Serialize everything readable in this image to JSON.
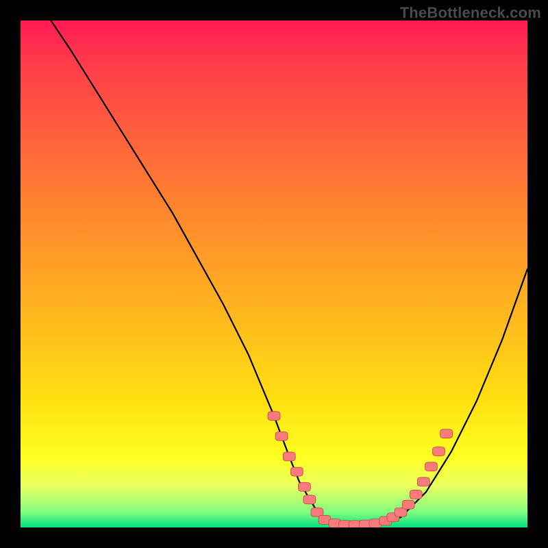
{
  "watermark": "TheBottleneck.com",
  "chart_data": {
    "type": "line",
    "title": "",
    "xlabel": "",
    "ylabel": "",
    "xlim": [
      0,
      100
    ],
    "ylim": [
      0,
      100
    ],
    "series": [
      {
        "name": "curve",
        "x": [
          6,
          10,
          15,
          20,
          25,
          30,
          35,
          40,
          45,
          50,
          53,
          55,
          58,
          60,
          62,
          65,
          68,
          70,
          75,
          80,
          85,
          90,
          95,
          100
        ],
        "y": [
          100,
          94,
          86,
          78,
          70,
          62,
          53,
          44,
          34,
          22,
          14,
          9,
          4,
          1.5,
          0.5,
          0.3,
          0.3,
          0.6,
          2,
          7,
          15,
          25,
          37,
          51
        ]
      }
    ],
    "markers": [
      {
        "x": 50.0,
        "y": 22.0
      },
      {
        "x": 51.5,
        "y": 18.0
      },
      {
        "x": 53.0,
        "y": 14.0
      },
      {
        "x": 54.5,
        "y": 11.0
      },
      {
        "x": 56.0,
        "y": 8.0
      },
      {
        "x": 57.0,
        "y": 5.5
      },
      {
        "x": 58.5,
        "y": 3.0
      },
      {
        "x": 60.0,
        "y": 1.5
      },
      {
        "x": 62.0,
        "y": 0.8
      },
      {
        "x": 64.0,
        "y": 0.5
      },
      {
        "x": 66.0,
        "y": 0.5
      },
      {
        "x": 68.0,
        "y": 0.6
      },
      {
        "x": 70.0,
        "y": 0.8
      },
      {
        "x": 72.0,
        "y": 1.3
      },
      {
        "x": 73.5,
        "y": 2.0
      },
      {
        "x": 75.0,
        "y": 3.0
      },
      {
        "x": 76.5,
        "y": 4.5
      },
      {
        "x": 78.0,
        "y": 6.5
      },
      {
        "x": 79.5,
        "y": 9.0
      },
      {
        "x": 81.0,
        "y": 12.0
      },
      {
        "x": 82.5,
        "y": 15.0
      },
      {
        "x": 84.0,
        "y": 18.5
      }
    ],
    "marker_color": "#f77b7b",
    "curve_color": "#000000"
  }
}
